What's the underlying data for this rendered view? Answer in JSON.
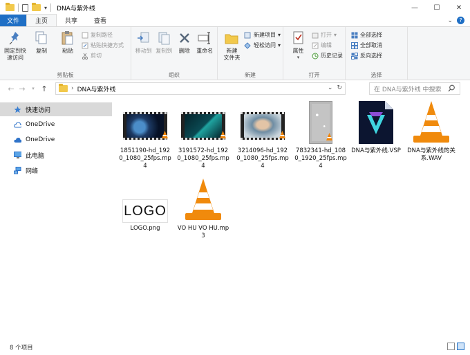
{
  "titlebar": {
    "title": "DNA与紫外线",
    "controls": [
      "—",
      "☐",
      "✕"
    ]
  },
  "tabs": [
    {
      "label": "文件"
    },
    {
      "label": "主页"
    },
    {
      "label": "共享"
    },
    {
      "label": "查看"
    }
  ],
  "ribbon": {
    "clipboard": {
      "label": "剪贴板",
      "pin": "固定到快\n速访问",
      "copy": "复制",
      "paste": "粘贴",
      "copy_path": "复制路径",
      "paste_shortcut": "粘贴快捷方式",
      "cut": "剪切"
    },
    "organize": {
      "label": "组织",
      "move_to": "移动到",
      "copy_to": "复制到",
      "delete": "删除",
      "rename": "重命名"
    },
    "new": {
      "label": "新建",
      "new_folder": "新建\n文件夹",
      "new_item": "新建项目",
      "easy_access": "轻松访问"
    },
    "open": {
      "label": "打开",
      "properties": "属性",
      "open": "打开",
      "edit": "编辑",
      "history": "历史记录"
    },
    "select": {
      "label": "选择",
      "select_all": "全部选择",
      "select_none": "全部取消",
      "invert": "反向选择"
    }
  },
  "address": {
    "path": "DNA与紫外线",
    "search_placeholder": "在 DNA与紫外线 中搜索"
  },
  "nav": {
    "items": [
      {
        "label": "快速访问",
        "icon": "star-icon"
      },
      {
        "label": "OneDrive",
        "icon": "cloud-icon"
      },
      {
        "label": "OneDrive",
        "icon": "cloud-icon"
      },
      {
        "label": "此电脑",
        "icon": "computer-icon"
      },
      {
        "label": "网络",
        "icon": "network-icon"
      }
    ]
  },
  "files": [
    {
      "name": "1851190-hd_1920_1080_25fps.mp4",
      "type": "video"
    },
    {
      "name": "3191572-hd_1920_1080_25fps.mp4",
      "type": "video"
    },
    {
      "name": "3214096-hd_1920_1080_25fps.mp4",
      "type": "video"
    },
    {
      "name": "7832341-hd_1080_1920_25fps.mp4",
      "type": "video-portrait"
    },
    {
      "name": "DNA与紫外线.VSP",
      "type": "vsp"
    },
    {
      "name": "DNA与紫外线的关系.WAV",
      "type": "audio"
    },
    {
      "name": "LOGO.png",
      "type": "image",
      "thumb_text": "LOGO"
    },
    {
      "name": "VO HU VO HU.mp3",
      "type": "audio"
    }
  ],
  "status": {
    "count": "8 个项目"
  },
  "colors": {
    "accent": "#1f6fc5",
    "vlc_orange": "#f0850a",
    "folder": "#f2c94c"
  }
}
